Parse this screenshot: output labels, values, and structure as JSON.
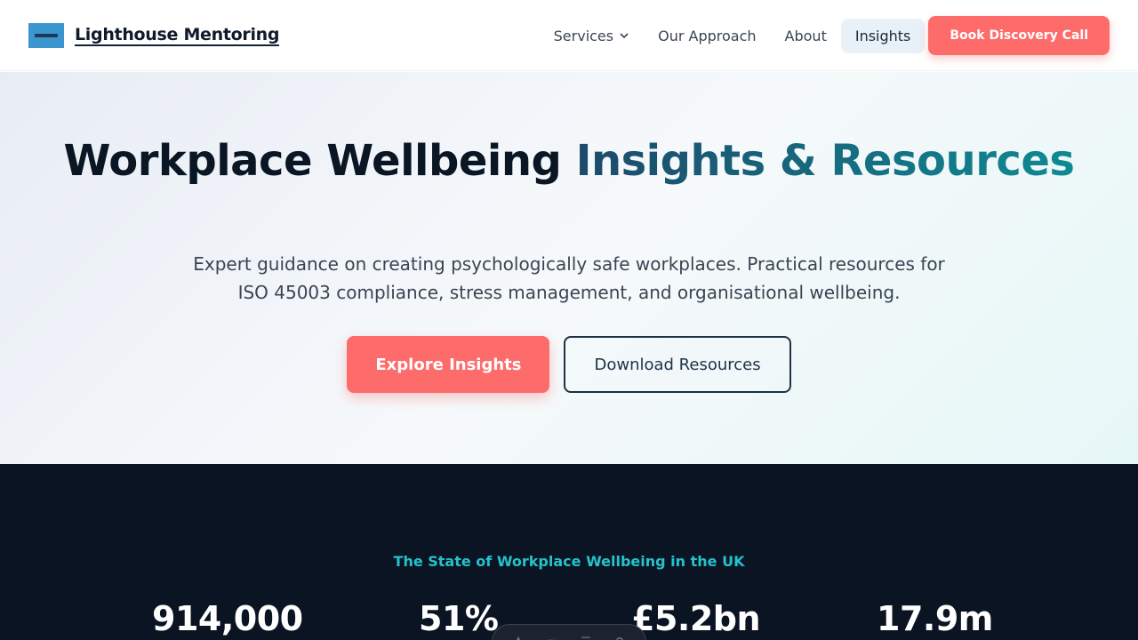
{
  "header": {
    "brand_name": "Lighthouse Mentoring",
    "nav": {
      "services": "Services",
      "approach": "Our Approach",
      "about": "About",
      "insights": "Insights",
      "cta": "Book Discovery Call"
    }
  },
  "hero": {
    "title_part1": "Workplace Wellbeing ",
    "title_accent": "Insights & Resources",
    "subtitle": "Expert guidance on creating psychologically safe workplaces. Practical resources for ISO 45003 compliance, stress management, and organisational wellbeing.",
    "primary_button": "Explore Insights",
    "secondary_button": "Download Resources"
  },
  "stats": {
    "heading": "The State of Workplace Wellbeing in the UK",
    "items": [
      {
        "value": "914,000"
      },
      {
        "value": "51%"
      },
      {
        "value": "£5.2bn"
      },
      {
        "value": "17.9m"
      }
    ]
  },
  "colors": {
    "accent_coral": "#fd6b6b",
    "dark_navy": "#0a1422",
    "teal": "#25c2cc"
  }
}
